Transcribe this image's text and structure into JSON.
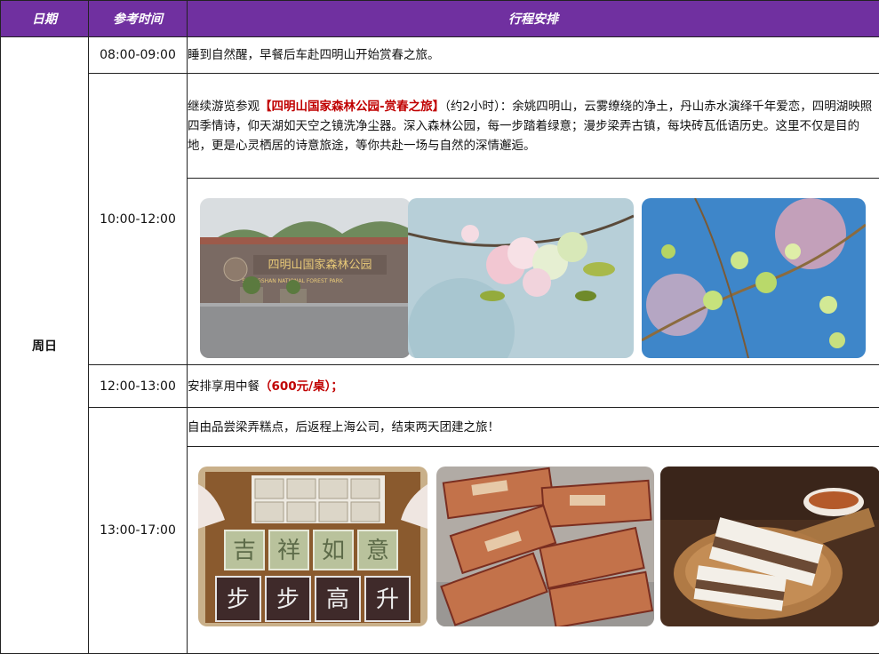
{
  "header": {
    "date": "日期",
    "time": "参考时间",
    "schedule": "行程安排"
  },
  "day": "周日",
  "rows": [
    {
      "time": "08:00-09:00",
      "text": "睡到自然醒，早餐后车赴四明山开始赏春之旅。"
    },
    {
      "time": "10:00-12:00",
      "pre": "继续游览参观",
      "highlight": "【四明山国家森林公园-赏春之旅】",
      "post": "（约2小时）：余姚四明山，云雾缭绕的净土，丹山赤水演绎千年爱恋，四明湖映照四季情诗，仰天湖如天空之镜洗净尘器。深入森林公园，每一步踏着绿意；漫步梁弄古镇，每块砖瓦低语历史。这里不仅是目的地，更是心灵栖居的诗意旅途，等你共赴一场与自然的深情邂逅。",
      "images": [
        {
          "icon": "park-entrance-photo",
          "sign": "四明山国家森林公园",
          "sign_en": "SIMINGSHAN NATIONAL FOREST PARK"
        },
        {
          "icon": "cherry-blossom-photo"
        },
        {
          "icon": "green-blossom-photo"
        }
      ]
    },
    {
      "time": "12:00-13:00",
      "pre": "安排享用中餐",
      "highlight": "（600元/桌）；"
    },
    {
      "time": "13:00-17:00",
      "text": "自由品尝梁弄糕点，后返程上海公司，结束两天团建之旅！",
      "images": [
        {
          "icon": "rice-cake-tray-photo",
          "cake_labels": [
            "吉",
            "祥",
            "如",
            "意",
            "步",
            "步",
            "高",
            "升"
          ]
        },
        {
          "icon": "wrapped-cake-photo"
        },
        {
          "icon": "layered-cake-tea-photo"
        }
      ]
    }
  ],
  "colors": {
    "header_bg": "#7030a0",
    "highlight": "#c00000"
  }
}
